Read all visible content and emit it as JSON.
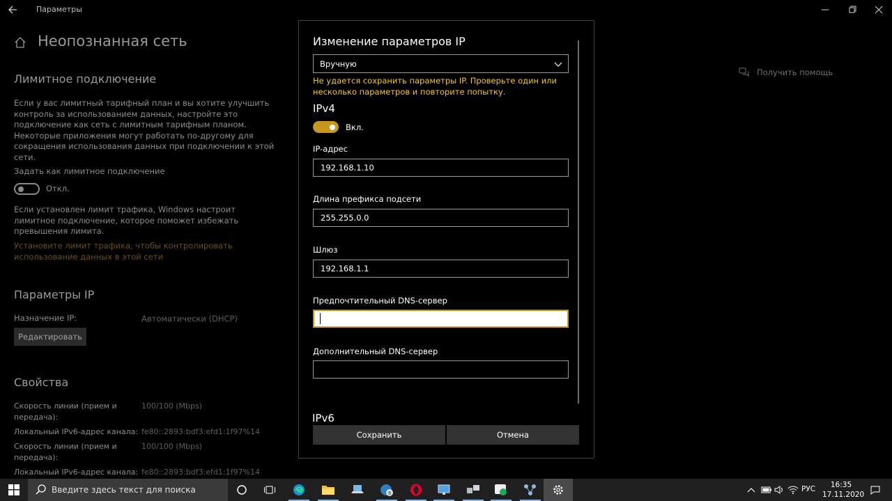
{
  "window": {
    "app_title": "Параметры",
    "page_title": "Неопознанная сеть"
  },
  "metered": {
    "heading": "Лимитное подключение",
    "description": "Если у вас лимитный тарифный план и вы хотите улучшить контроль за использованием данных, настройте это подключение как сеть с лимитным тарифным планом. Некоторые приложения могут работать по-другому для сокращения использования данных при подключении к этой сети.",
    "toggle_caption": "Задать как лимитное подключение",
    "toggle_state": "Откл.",
    "limit_note": "Если установлен лимит трафика, Windows настроит лимитное подключение, которое поможет избежать превышения лимита.",
    "limit_link": "Установите лимит трафика, чтобы контролировать использование данных в этой сети"
  },
  "ip_settings": {
    "heading": "Параметры IP",
    "assign_label": "Назначение IP:",
    "assign_value": "Автоматически (DHCP)",
    "edit_button": "Редактировать"
  },
  "properties": {
    "heading": "Свойства",
    "rows": [
      {
        "label": "Скорость линии (прием и передача):",
        "value": "100/100 (Mbps)"
      },
      {
        "label": "Локальный IPv6-адрес канала:",
        "value": "fe80::2893:bdf3:efd1:1f97%14"
      },
      {
        "label": "Скорость линии (прием и передача):",
        "value": "100/100 (Mbps)"
      },
      {
        "label": "Локальный IPv6-адрес канала:",
        "value": "fe80::2893:bdf3:efd1:1f97%14"
      }
    ]
  },
  "help": {
    "label": "Получить помощь"
  },
  "dialog": {
    "title": "Изменение параметров IP",
    "mode_selected": "Вручную",
    "error": "Не удается сохранить параметры IP. Проверьте один или несколько параметров и повторите попытку.",
    "ipv4_heading": "IPv4",
    "ipv4_toggle_state": "Вкл.",
    "ip_label": "IP-адрес",
    "ip_value": "192.168.1.10",
    "prefix_label": "Длина префикса подсети",
    "prefix_value": "255.255.0.0",
    "gateway_label": "Шлюз",
    "gateway_value": "192.168.1.1",
    "dns1_label": "Предпочтительный DNS-сервер",
    "dns1_value": "",
    "dns2_label": "Дополнительный DNS-сервер",
    "dns2_value": "",
    "ipv6_heading": "IPv6",
    "save_button": "Сохранить",
    "cancel_button": "Отмена"
  },
  "taskbar": {
    "search_placeholder": "Введите здесь текст для поиска",
    "language": "РУС",
    "time": "16:35",
    "date": "17.11.2020"
  },
  "colors": {
    "accent": "#c9961e",
    "error_text": "#f5c518",
    "background": "#000000",
    "taskbar": "#202020"
  }
}
